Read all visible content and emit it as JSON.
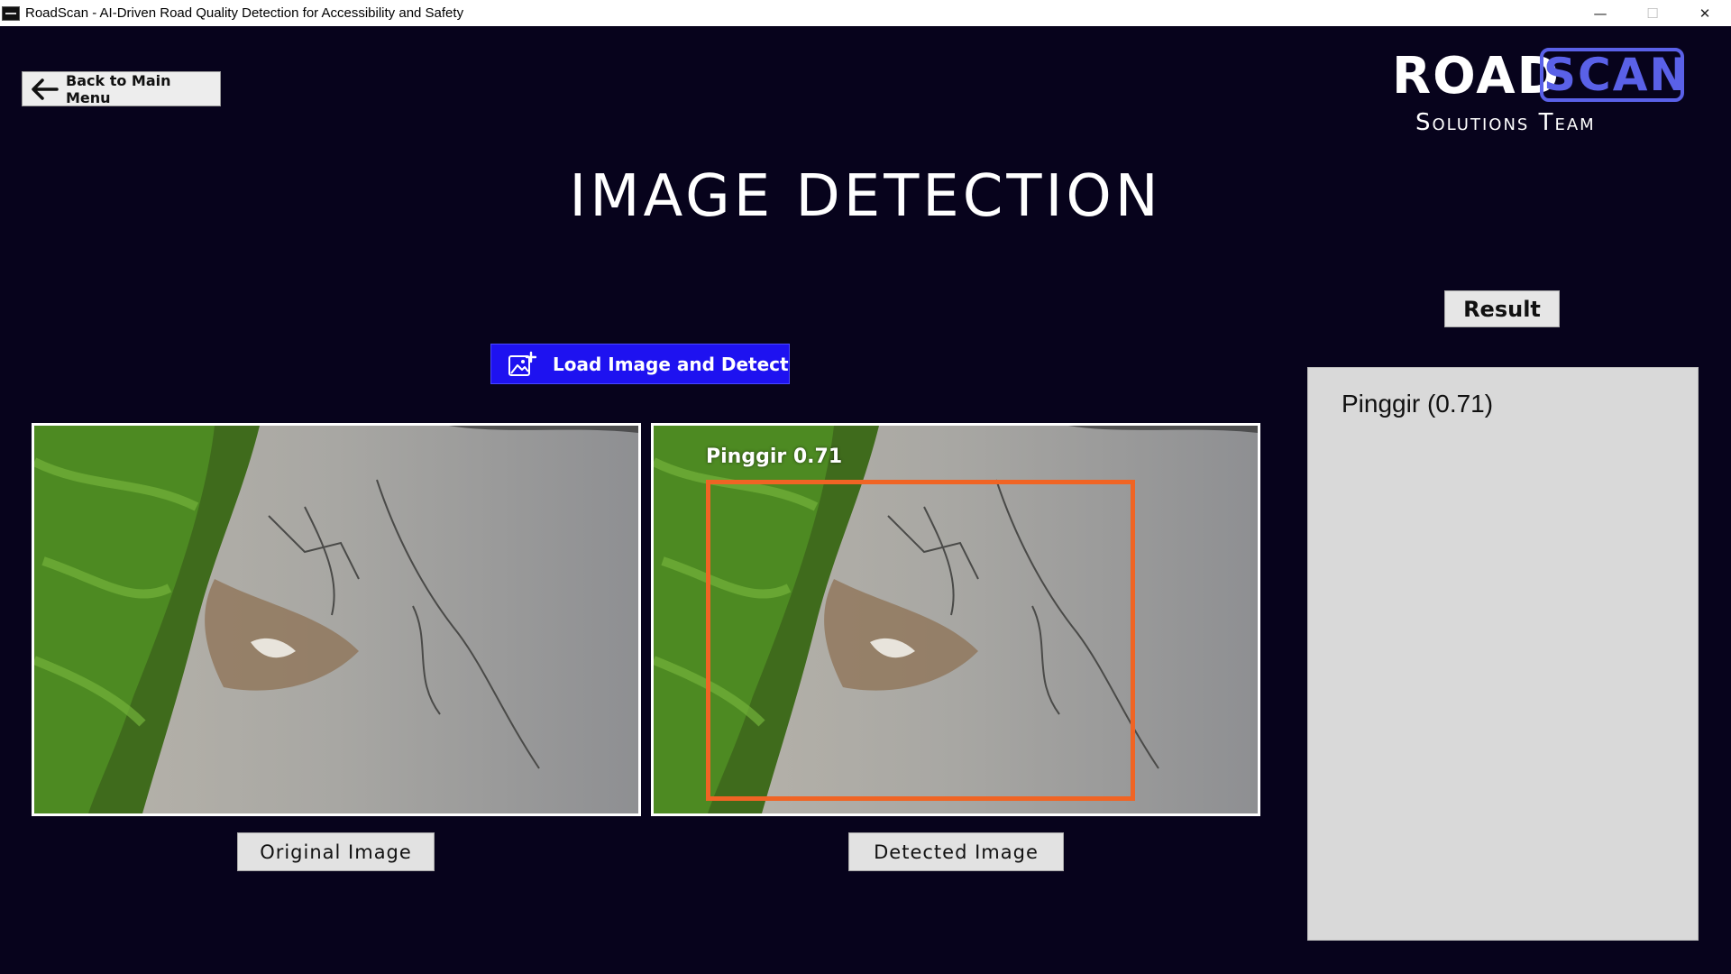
{
  "window": {
    "title": "RoadScan - AI-Driven Road Quality Detection for Accessibility and Safety",
    "minimize_glyph": "—",
    "maximize_glyph": "☐",
    "close_glyph": "✕"
  },
  "nav": {
    "back_label": "Back to Main Menu"
  },
  "logo": {
    "word1": "ROAD",
    "word2": "SCAN",
    "subtitle": "Solutions Team"
  },
  "page": {
    "title": "IMAGE DETECTION"
  },
  "actions": {
    "load_label": "Load Image and Detect"
  },
  "images": {
    "original_caption": "Original Image",
    "detected_caption": "Detected Image",
    "detection_label": "Pinggir 0.71"
  },
  "result": {
    "button_label": "Result",
    "items": [
      "Pinggir (0.71)"
    ]
  },
  "colors": {
    "background": "#07031c",
    "accent_blue": "#1e12f0",
    "logo_blue": "#5a61e8",
    "detection_box": "#f06424",
    "panel": "#d9d9d9"
  },
  "icons": [
    "app-icon",
    "back-arrow-icon",
    "image-add-icon"
  ]
}
